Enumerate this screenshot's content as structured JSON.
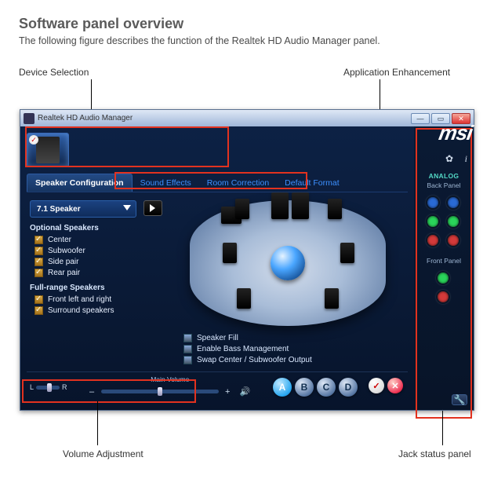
{
  "doc": {
    "heading": "Software panel overview",
    "subheading": "The following figure describes the function of the Realtek HD Audio Manager panel.",
    "callouts": {
      "device_selection": "Device Selection",
      "application_enhancement": "Application Enhancement",
      "volume_adjustment": "Volume Adjustment",
      "jack_status_panel": "Jack status panel"
    }
  },
  "window": {
    "title": "Realtek HD Audio Manager",
    "min": "—",
    "max": "▭",
    "close": "✕",
    "brand": "msi"
  },
  "tabs": [
    {
      "label": "Speaker Configuration",
      "active": true
    },
    {
      "label": "Sound Effects",
      "active": false
    },
    {
      "label": "Room Correction",
      "active": false
    },
    {
      "label": "Default Format",
      "active": false
    }
  ],
  "config": {
    "dropdown": "7.1 Speaker",
    "optional_title": "Optional Speakers",
    "optional": [
      "Center",
      "Subwoofer",
      "Side pair",
      "Rear pair"
    ],
    "fullrange_title": "Full-range Speakers",
    "fullrange": [
      "Front left and right",
      "Surround speakers"
    ],
    "right_checks": [
      "Speaker Fill",
      "Enable Bass Management",
      "Swap Center / Subwoofer Output"
    ]
  },
  "volume": {
    "balance_left": "L",
    "balance_right": "R",
    "main_label": "Main Volume",
    "minus": "–",
    "plus": "+",
    "speaker_icon": "🔊"
  },
  "buttons": {
    "a": "A",
    "b": "B",
    "c": "C",
    "d": "D",
    "check": "✓",
    "x": "✕"
  },
  "sidebar": {
    "gear": "✿",
    "info": "i",
    "analog": "ANALOG",
    "back_panel": "Back Panel",
    "front_panel": "Front Panel",
    "wrench": "🔧",
    "jack_colors_back": [
      "#2a6ad4",
      "#2a6ad4",
      "#2ad45a",
      "#2ad45a",
      "#d43a3a",
      "#d43a3a"
    ],
    "jack_colors_front": [
      "#2ad45a",
      "#d43a3a"
    ]
  }
}
